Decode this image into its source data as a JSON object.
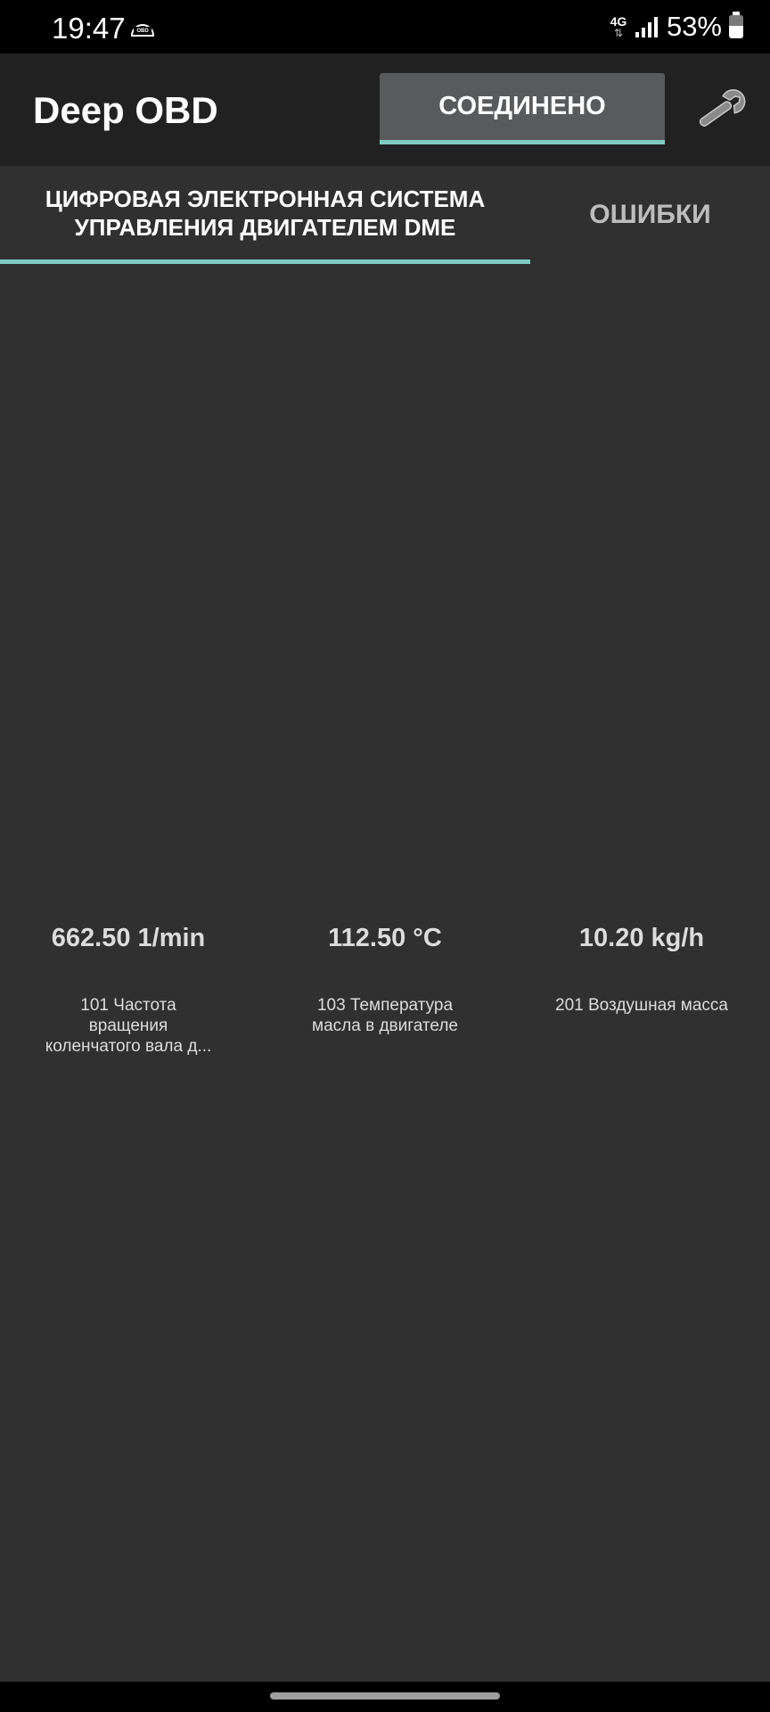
{
  "status_bar": {
    "time": "19:47",
    "notification_icon": "obd-icon",
    "network_type": "4G",
    "battery_percent": "53%",
    "battery_level": 0.53
  },
  "app_bar": {
    "title": "Deep OBD",
    "connect_button_label": "СОЕДИНЕНО",
    "settings_icon": "wrench-icon"
  },
  "tabs": [
    {
      "label": "ЦИФРОВАЯ ЭЛЕКТРОННАЯ СИСТЕМА УПРАВЛЕНИЯ ДВИГАТЕЛЕМ DME",
      "selected": true
    },
    {
      "label": "ОШИБКИ",
      "selected": false
    }
  ],
  "gauges": [
    {
      "value": "662.50 1/min",
      "label": "101 Частота вращения коленчатого вала д..."
    },
    {
      "value": "112.50 °C",
      "label": "103 Температура масла в двигателе"
    },
    {
      "value": "10.20 kg/h",
      "label": "201 Воздушная масса"
    }
  ],
  "colors": {
    "accent": "#80cbc4",
    "app_bar": "#212121",
    "background": "#303030",
    "button": "#595a5c"
  }
}
